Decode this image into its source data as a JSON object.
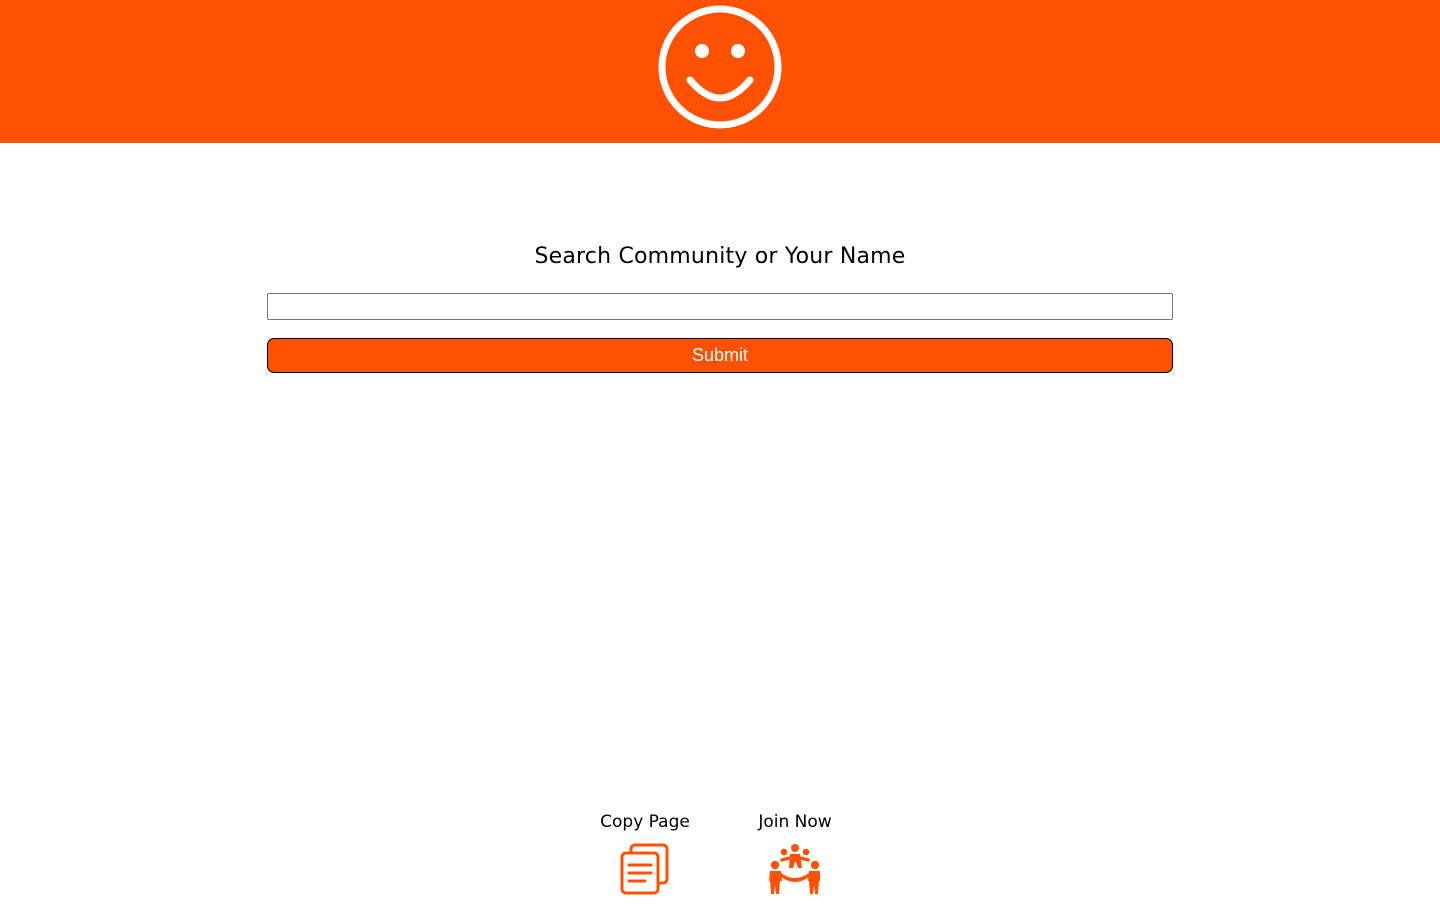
{
  "header": {
    "logo_icon": "smiley-face-icon",
    "background_color": "#ff5103"
  },
  "search": {
    "title": "Search Community or Your Name",
    "input_value": "",
    "placeholder": "",
    "submit_label": "Submit"
  },
  "footer": {
    "items": [
      {
        "label": "Copy Page",
        "icon": "copy-page-icon"
      },
      {
        "label": "Join Now",
        "icon": "people-group-icon"
      }
    ]
  },
  "colors": {
    "accent": "#ff5103",
    "text": "#000000",
    "background": "#ffffff"
  }
}
